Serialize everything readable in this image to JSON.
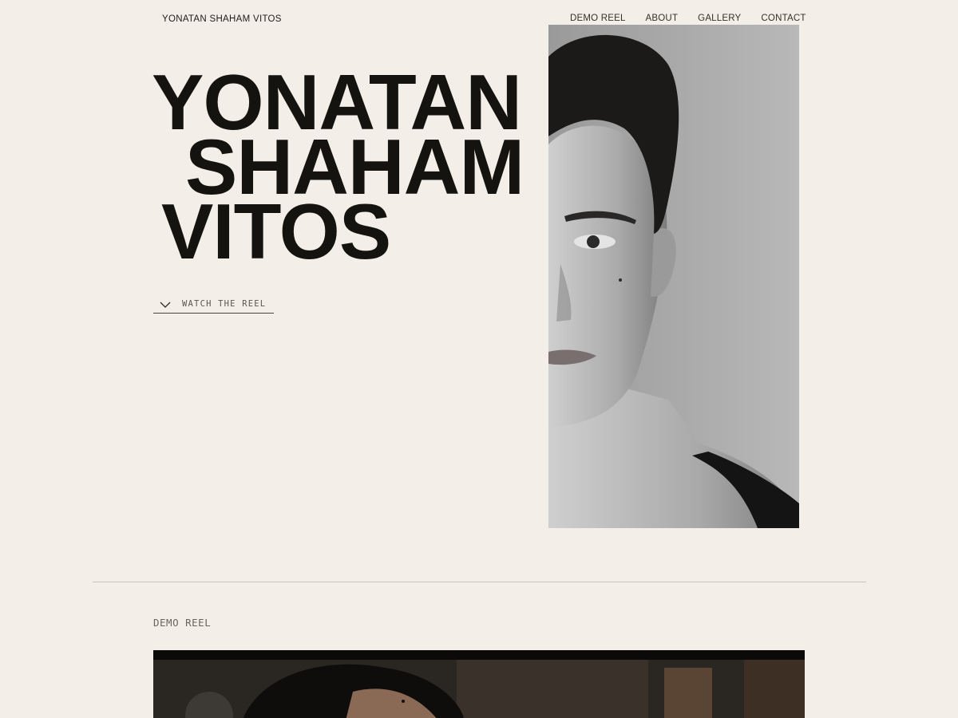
{
  "header": {
    "site_name": "YONATAN SHAHAM VITOS",
    "nav": [
      "DEMO REEL",
      "ABOUT",
      "GALLERY",
      "CONTACT"
    ]
  },
  "hero": {
    "name_lines": [
      "YONATAN",
      "SHAHAM",
      "VITOS"
    ],
    "cta_label": "WATCH THE REEL",
    "cta_icon": "chevron-down-icon"
  },
  "demo_section": {
    "label": "DEMO REEL"
  }
}
